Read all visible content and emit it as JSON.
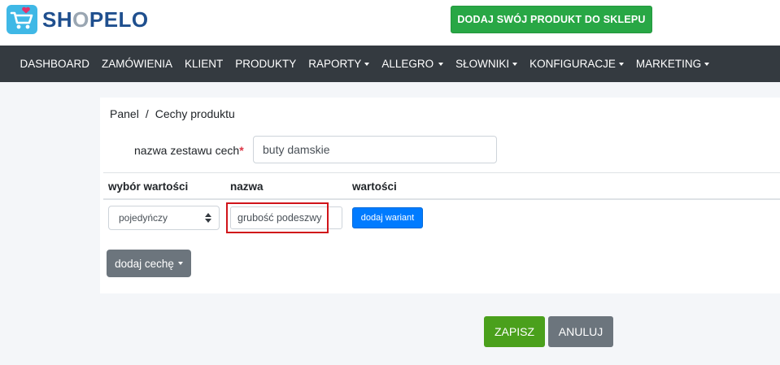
{
  "brand": {
    "name_prefix": "SH",
    "name_o": "O",
    "name_suffix": "PELO",
    "icon": "shopping-cart-heart-icon"
  },
  "header": {
    "cta_label": "DODAJ SWÓJ PRODUKT DO SKLEPU"
  },
  "nav": {
    "items": [
      {
        "label": "DASHBOARD",
        "dropdown": false
      },
      {
        "label": "ZAMÓWIENIA",
        "dropdown": false
      },
      {
        "label": "KLIENT",
        "dropdown": false
      },
      {
        "label": "PRODUKTY",
        "dropdown": false
      },
      {
        "label": "RAPORTY",
        "dropdown": true
      },
      {
        "label": "ALLEGRO",
        "dropdown": true
      },
      {
        "label": "SŁOWNIKI",
        "dropdown": true
      },
      {
        "label": "KONFIGURACJE",
        "dropdown": true
      },
      {
        "label": "MARKETING",
        "dropdown": true
      }
    ]
  },
  "breadcrumb": {
    "root": "Panel",
    "separator": "/",
    "current": "Cechy produktu"
  },
  "form": {
    "set_name_label": "nazwa zestawu cech",
    "required_mark": "*",
    "set_name_value": "buty damskie"
  },
  "table": {
    "headers": [
      "wybór wartości",
      "nazwa",
      "wartości"
    ],
    "row": {
      "select_value": "pojedyńczy",
      "name_value": "grubość podeszwy",
      "add_variant_label": "dodaj wariant"
    }
  },
  "actions": {
    "add_feature_label": "dodaj cechę",
    "save_label": "ZAPISZ",
    "cancel_label": "ANULUJ"
  },
  "colors": {
    "brand_blue": "#1f4f8e",
    "cta_green": "#28a745",
    "nav_bg": "#343a40",
    "primary_blue": "#007bff",
    "save_green": "#4aa01c",
    "secondary_gray": "#6c757d",
    "highlight_red": "#d0141a"
  }
}
